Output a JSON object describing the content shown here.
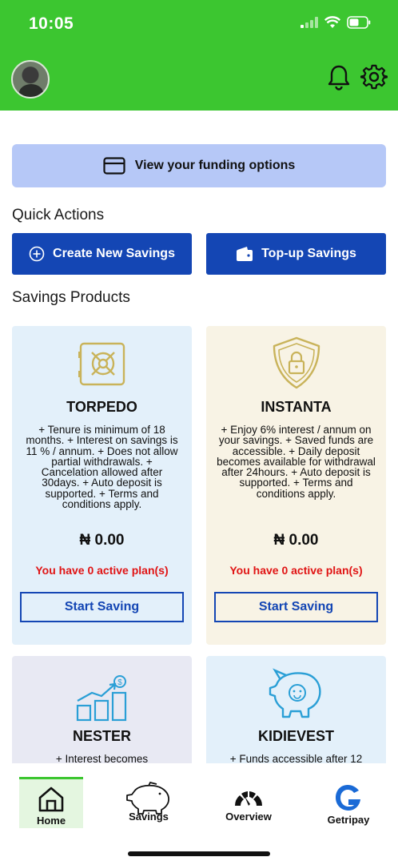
{
  "status_bar": {
    "time": "10:05"
  },
  "header": {
    "avatar": "profile-avatar",
    "icons": [
      "bell-icon",
      "gear-icon"
    ]
  },
  "funding": {
    "label": "View your funding options",
    "icon": "card-icon"
  },
  "quick_actions": {
    "title": "Quick Actions",
    "create_label": "Create New Savings",
    "topup_label": "Top-up Savings"
  },
  "savings_products": {
    "title": "Savings Products",
    "products": [
      {
        "name": "TORPEDO",
        "description": "+ Tenure is minimum of 18 months. + Interest on savings is 11 % / annum.  + Does not allow partial withdrawals. + Cancelation allowed after 30days.  + Auto deposit is supported. + Terms and conditions apply.",
        "amount": "₦ 0.00",
        "plans": "You have 0 active plan(s)",
        "button": "Start Saving",
        "bg": "#e3f0fa",
        "icon": "vault-icon"
      },
      {
        "name": "INSTANTA",
        "description": "+ Enjoy 6% interest / annum on your savings. + Saved funds are accessible. + Daily deposit becomes available for withdrawal after 24hours. + Auto deposit is supported. + Terms and conditions apply.",
        "amount": "₦ 0.00",
        "plans": "You have 0 active plan(s)",
        "button": "Start Saving",
        "bg": "#f8f3e5",
        "icon": "shield-lock-icon"
      },
      {
        "name": "NESTER",
        "description": "+ Interest becomes",
        "bg": "#e8e9f3",
        "icon": "growth-chart-icon"
      },
      {
        "name": "KIDIEVEST",
        "description": "+ Funds accessible after 12",
        "bg": "#e3f0fa",
        "icon": "piggy-bank-icon"
      }
    ]
  },
  "bottom_nav": {
    "items": [
      {
        "label": "Home",
        "icon": "home-icon",
        "active": true
      },
      {
        "label": "Savings",
        "icon": "piggy-icon",
        "active": false
      },
      {
        "label": "Overview",
        "icon": "gauge-icon",
        "active": false
      },
      {
        "label": "Getripay",
        "icon": "getripay-logo-icon",
        "active": false
      }
    ]
  },
  "colors": {
    "brand_green": "#3cc630",
    "primary_blue": "#1446b4",
    "alert_red": "#e01414",
    "funding_bg": "#b6c8f7"
  }
}
